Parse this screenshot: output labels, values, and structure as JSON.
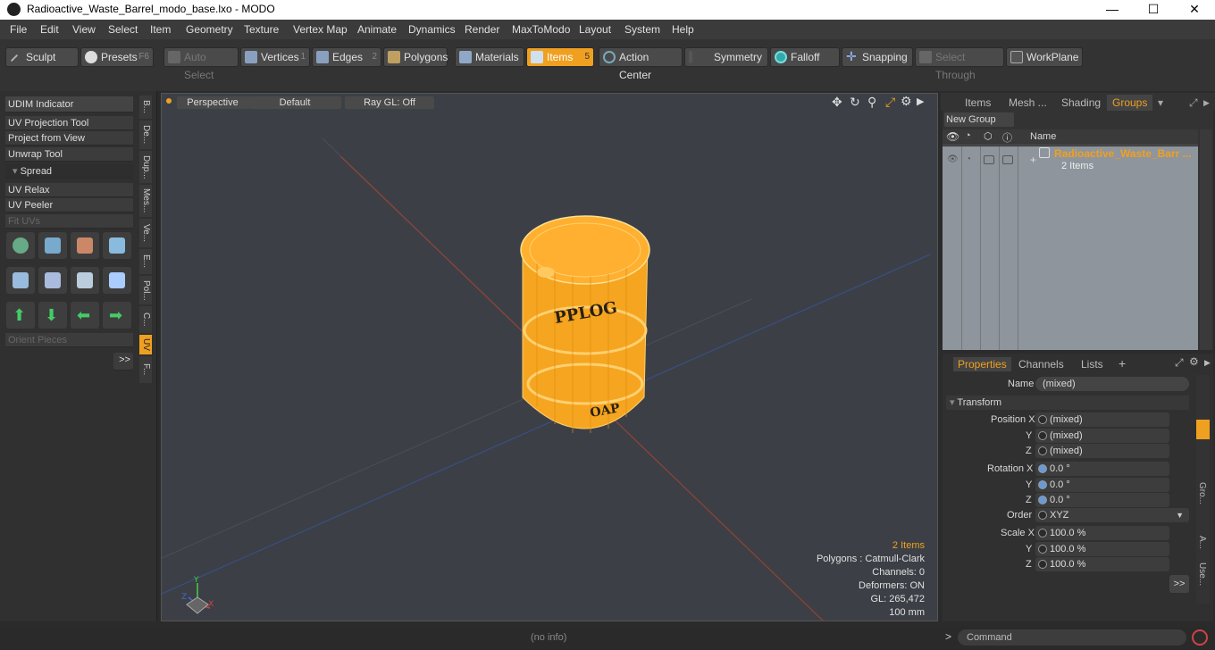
{
  "window": {
    "title": "Radioactive_Waste_Barrel_modo_base.lxo - MODO",
    "minimize": "—",
    "maximize": "☐",
    "close": "✕"
  },
  "menu": [
    "File",
    "Edit",
    "View",
    "Select",
    "Item",
    "Geometry",
    "Texture",
    "Vertex Map",
    "Animate",
    "Dynamics",
    "Render",
    "MaxToModo",
    "Layout",
    "System",
    "Help"
  ],
  "toolbar": {
    "sculpt": "Sculpt",
    "presets": "Presets",
    "presets_key": "F6",
    "auto_select": "Auto Select",
    "vertices": "Vertices",
    "vertices_num": "1",
    "edges": "Edges",
    "edges_num": "2",
    "polygons": "Polygons",
    "materials": "Materials",
    "items": "Items",
    "items_num": "5",
    "action_center": "Action Center",
    "symmetry": "Symmetry",
    "falloff": "Falloff",
    "snapping": "Snapping",
    "select_through": "Select Through",
    "workplane": "WorkPlane"
  },
  "left": {
    "udim": "UDIM Indicator",
    "uv_projection": "UV Projection Tool",
    "project_view": "Project from View",
    "unwrap": "Unwrap Tool",
    "spread": "Spread",
    "uv_relax": "UV Relax",
    "uv_peeler": "UV Peeler",
    "fit_uvs": "Fit UVs",
    "orient": "Orient Pieces",
    "more": ">>",
    "vtabs": [
      "B...",
      "De...",
      "Dup...",
      "Mes...",
      "Ve...",
      "E...",
      "Pol...",
      "C...",
      "UV",
      "F..."
    ]
  },
  "viewport": {
    "perspective": "Perspective",
    "default": "Default",
    "raygl": "Ray GL: Off",
    "info": {
      "items": "2 Items",
      "polygons": "Polygons : Catmull-Clark",
      "channels": "Channels: 0",
      "deformers": "Deformers: ON",
      "gl": "GL: 265,472",
      "scale": "100 mm"
    }
  },
  "groups": {
    "tabs": [
      "Items",
      "Mesh ...",
      "Shading",
      "Groups"
    ],
    "new_group": "New Group",
    "col_name": "Name",
    "row_name": "Radioactive_Waste_Barr ...",
    "row_sub": "2 Items"
  },
  "props": {
    "tabs": [
      "Properties",
      "Channels",
      "Lists"
    ],
    "name_label": "Name",
    "name_value": "(mixed)",
    "transform": "Transform",
    "pos_label": "Position X",
    "rot_label": "Rotation X",
    "order_label": "Order",
    "scale_label": "Scale X",
    "y": "Y",
    "z": "Z",
    "pos": [
      "(mixed)",
      "(mixed)",
      "(mixed)"
    ],
    "rot": [
      "0.0 °",
      "0.0 °",
      "0.0 °"
    ],
    "order": "XYZ",
    "scale": [
      "100.0 %",
      "100.0 %",
      "100.0 %"
    ],
    "more": ">>",
    "side_tabs": [
      "Gro...",
      "A...",
      "Use..."
    ]
  },
  "status": {
    "info": "(no info)",
    "command": "Command",
    "prompt": ">"
  },
  "colors": {
    "accent": "#f0a020",
    "viewport_bg": "#3c4046"
  }
}
